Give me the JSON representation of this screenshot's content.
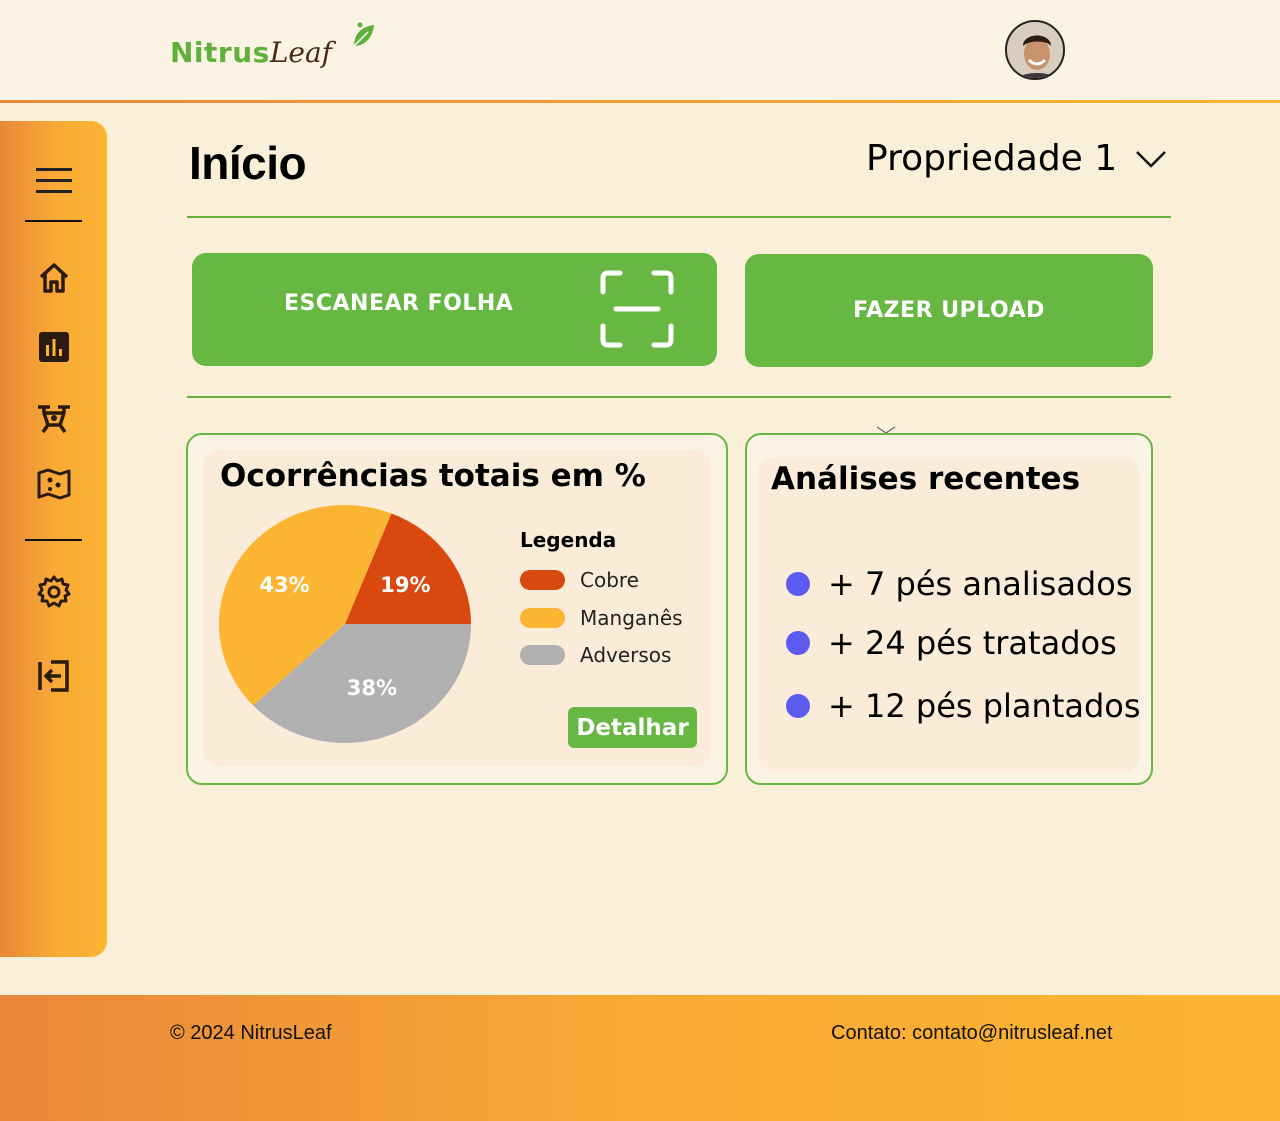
{
  "header": {
    "logo_part1": "Nitrus",
    "logo_part2": "Leaf"
  },
  "sidebar": {
    "items": [
      {
        "icon": "menu-icon"
      },
      {
        "icon": "home-icon"
      },
      {
        "icon": "bar-chart-icon"
      },
      {
        "icon": "drone-icon"
      },
      {
        "icon": "map-icon"
      },
      {
        "icon": "gear-icon"
      },
      {
        "icon": "logout-icon"
      }
    ]
  },
  "main": {
    "title": "Início",
    "property_select": "Propriedade 1",
    "scan_button": "ESCANEAR FOLHA",
    "upload_button": "FAZER UPLOAD"
  },
  "occurrences": {
    "title": "Ocorrências totais em %",
    "legend_title": "Legenda",
    "detail_button": "Detalhar"
  },
  "chart_data": {
    "type": "pie",
    "title": "Ocorrências totais em %",
    "slices": [
      {
        "label": "Cobre",
        "value": 19,
        "display": "19%",
        "color": "#d9490f"
      },
      {
        "label": "Adversos",
        "value": 38,
        "display": "38%",
        "color": "#b0b0b0"
      },
      {
        "label": "Manganês",
        "value": 43,
        "display": "43%",
        "color": "#fcb533"
      }
    ]
  },
  "recent": {
    "title": "Análises recentes",
    "items": [
      "+ 7 pés analisados",
      "+ 24 pés tratados",
      "+ 12 pés plantados"
    ],
    "bullet_color": "#5b5bf0"
  },
  "footer": {
    "copyright": "© 2024 NitrusLeaf",
    "contact": "Contato: contato@nitrusleaf.net"
  },
  "colors": {
    "accent_green": "#67b843",
    "orange_start": "#e8883a",
    "orange_end": "#fcb533"
  }
}
